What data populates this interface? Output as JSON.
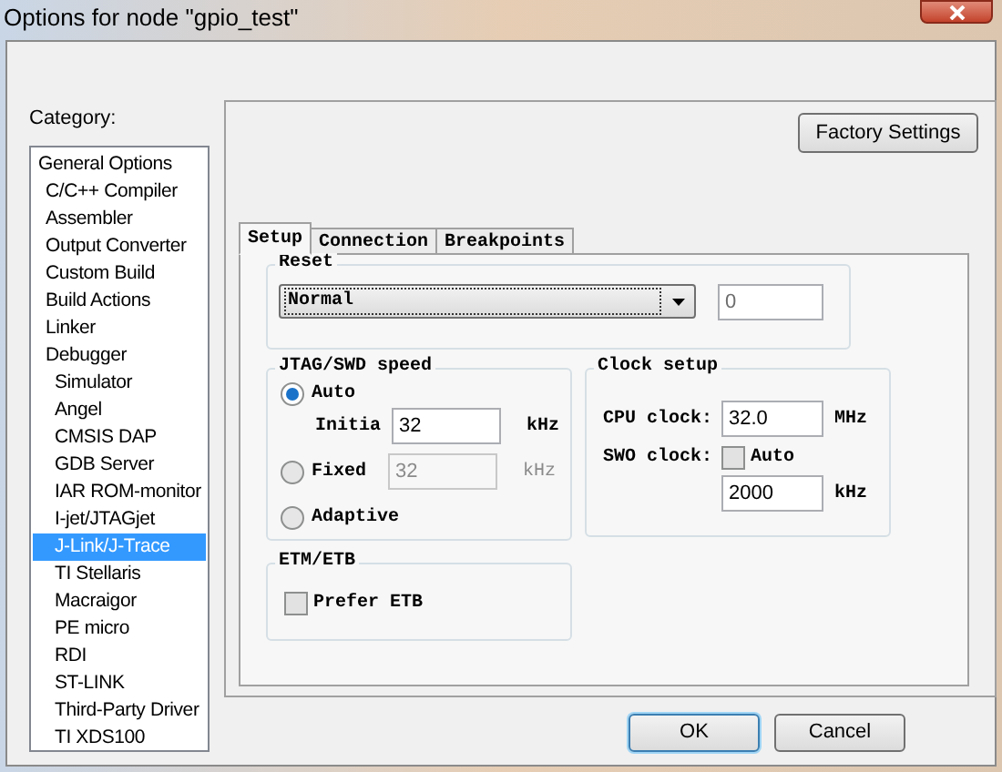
{
  "window": {
    "title": "Options for node \"gpio_test\""
  },
  "category": {
    "label": "Category:",
    "items": [
      {
        "label": "General Options",
        "selected": false
      },
      {
        "label": "C/C++ Compiler",
        "selected": false
      },
      {
        "label": "Assembler",
        "selected": false
      },
      {
        "label": "Output Converter",
        "selected": false
      },
      {
        "label": "Custom Build",
        "selected": false
      },
      {
        "label": "Build Actions",
        "selected": false
      },
      {
        "label": "Linker",
        "selected": false
      },
      {
        "label": "Debugger",
        "selected": false,
        "children": [
          {
            "label": "Simulator",
            "selected": false
          },
          {
            "label": "Angel",
            "selected": false
          },
          {
            "label": "CMSIS DAP",
            "selected": false
          },
          {
            "label": "GDB Server",
            "selected": false
          },
          {
            "label": "IAR ROM-monitor",
            "selected": false
          },
          {
            "label": "I-jet/JTAGjet",
            "selected": false
          },
          {
            "label": "J-Link/J-Trace",
            "selected": true
          },
          {
            "label": "TI Stellaris",
            "selected": false
          },
          {
            "label": "Macraigor",
            "selected": false
          },
          {
            "label": "PE micro",
            "selected": false
          },
          {
            "label": "RDI",
            "selected": false
          },
          {
            "label": "ST-LINK",
            "selected": false
          },
          {
            "label": "Third-Party Driver",
            "selected": false
          },
          {
            "label": "TI XDS100",
            "selected": false
          }
        ]
      }
    ]
  },
  "factory_button": "Factory Settings",
  "tabs": [
    {
      "label": "Setup",
      "selected": true
    },
    {
      "label": "Connection",
      "selected": false
    },
    {
      "label": "Breakpoints",
      "selected": false
    }
  ],
  "reset": {
    "title": "Reset",
    "value": "Normal",
    "field": "0"
  },
  "jtag_speed": {
    "title": "JTAG/SWD speed",
    "auto": {
      "label": "Auto",
      "selected": true
    },
    "initial": {
      "label": "Initia",
      "value": "32",
      "unit": "kHz",
      "disabled": false
    },
    "fixed": {
      "label": "Fixed",
      "selected": false,
      "value": "32",
      "unit": "kHz",
      "disabled": true
    },
    "adaptive": {
      "label": "Adaptive",
      "selected": false
    }
  },
  "clock_setup": {
    "title": "Clock setup",
    "cpu_clock": {
      "label": "CPU clock:",
      "value": "32.0",
      "unit": "MHz"
    },
    "swo_clock": {
      "label": "SWO clock:",
      "auto_label": "Auto",
      "auto_checked": false,
      "value": "2000",
      "unit": "kHz"
    }
  },
  "etm_etb": {
    "title": "ETM/ETB",
    "prefer_label": "Prefer ETB",
    "prefer_checked": false
  },
  "buttons": [
    {
      "label": "OK",
      "default": true
    },
    {
      "label": "Cancel",
      "default": false
    }
  ]
}
